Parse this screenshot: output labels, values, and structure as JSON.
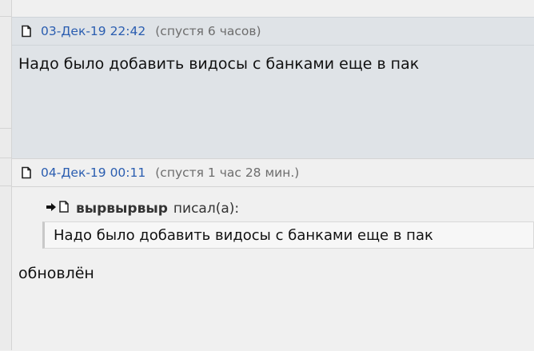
{
  "posts": [
    {
      "date": "03-Дек-19 22:42",
      "ago": "(спустя 6 часов)",
      "body": "Надо было добавить видосы с банками еще в пак"
    },
    {
      "date": "04-Дек-19 00:11",
      "ago": "(спустя 1 час 28 мин.)",
      "quote": {
        "author": "вырвырвыр",
        "wrote": "писал(а):",
        "text": "Надо было добавить видосы с банками еще в пак"
      },
      "body": "обновлён"
    }
  ],
  "icons": {
    "post": "document-icon",
    "quote_link": "arrow-right-icon"
  },
  "colors": {
    "date_link": "#2a5db0",
    "highlight_bg": "#dfe3e7"
  }
}
